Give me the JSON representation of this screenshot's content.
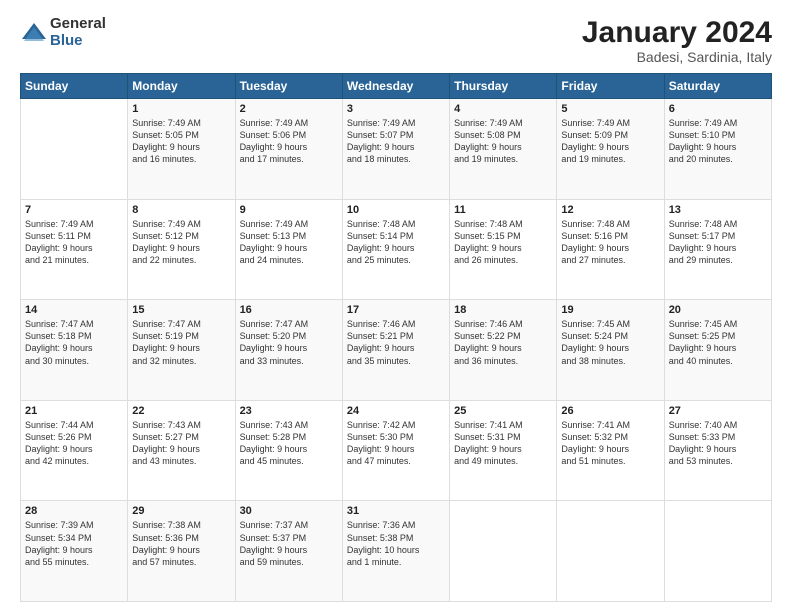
{
  "logo": {
    "general": "General",
    "blue": "Blue"
  },
  "title": "January 2024",
  "location": "Badesi, Sardinia, Italy",
  "days_of_week": [
    "Sunday",
    "Monday",
    "Tuesday",
    "Wednesday",
    "Thursday",
    "Friday",
    "Saturday"
  ],
  "weeks": [
    [
      {
        "day": "",
        "info": ""
      },
      {
        "day": "1",
        "info": "Sunrise: 7:49 AM\nSunset: 5:05 PM\nDaylight: 9 hours\nand 16 minutes."
      },
      {
        "day": "2",
        "info": "Sunrise: 7:49 AM\nSunset: 5:06 PM\nDaylight: 9 hours\nand 17 minutes."
      },
      {
        "day": "3",
        "info": "Sunrise: 7:49 AM\nSunset: 5:07 PM\nDaylight: 9 hours\nand 18 minutes."
      },
      {
        "day": "4",
        "info": "Sunrise: 7:49 AM\nSunset: 5:08 PM\nDaylight: 9 hours\nand 19 minutes."
      },
      {
        "day": "5",
        "info": "Sunrise: 7:49 AM\nSunset: 5:09 PM\nDaylight: 9 hours\nand 19 minutes."
      },
      {
        "day": "6",
        "info": "Sunrise: 7:49 AM\nSunset: 5:10 PM\nDaylight: 9 hours\nand 20 minutes."
      }
    ],
    [
      {
        "day": "7",
        "info": "Sunrise: 7:49 AM\nSunset: 5:11 PM\nDaylight: 9 hours\nand 21 minutes."
      },
      {
        "day": "8",
        "info": "Sunrise: 7:49 AM\nSunset: 5:12 PM\nDaylight: 9 hours\nand 22 minutes."
      },
      {
        "day": "9",
        "info": "Sunrise: 7:49 AM\nSunset: 5:13 PM\nDaylight: 9 hours\nand 24 minutes."
      },
      {
        "day": "10",
        "info": "Sunrise: 7:48 AM\nSunset: 5:14 PM\nDaylight: 9 hours\nand 25 minutes."
      },
      {
        "day": "11",
        "info": "Sunrise: 7:48 AM\nSunset: 5:15 PM\nDaylight: 9 hours\nand 26 minutes."
      },
      {
        "day": "12",
        "info": "Sunrise: 7:48 AM\nSunset: 5:16 PM\nDaylight: 9 hours\nand 27 minutes."
      },
      {
        "day": "13",
        "info": "Sunrise: 7:48 AM\nSunset: 5:17 PM\nDaylight: 9 hours\nand 29 minutes."
      }
    ],
    [
      {
        "day": "14",
        "info": "Sunrise: 7:47 AM\nSunset: 5:18 PM\nDaylight: 9 hours\nand 30 minutes."
      },
      {
        "day": "15",
        "info": "Sunrise: 7:47 AM\nSunset: 5:19 PM\nDaylight: 9 hours\nand 32 minutes."
      },
      {
        "day": "16",
        "info": "Sunrise: 7:47 AM\nSunset: 5:20 PM\nDaylight: 9 hours\nand 33 minutes."
      },
      {
        "day": "17",
        "info": "Sunrise: 7:46 AM\nSunset: 5:21 PM\nDaylight: 9 hours\nand 35 minutes."
      },
      {
        "day": "18",
        "info": "Sunrise: 7:46 AM\nSunset: 5:22 PM\nDaylight: 9 hours\nand 36 minutes."
      },
      {
        "day": "19",
        "info": "Sunrise: 7:45 AM\nSunset: 5:24 PM\nDaylight: 9 hours\nand 38 minutes."
      },
      {
        "day": "20",
        "info": "Sunrise: 7:45 AM\nSunset: 5:25 PM\nDaylight: 9 hours\nand 40 minutes."
      }
    ],
    [
      {
        "day": "21",
        "info": "Sunrise: 7:44 AM\nSunset: 5:26 PM\nDaylight: 9 hours\nand 42 minutes."
      },
      {
        "day": "22",
        "info": "Sunrise: 7:43 AM\nSunset: 5:27 PM\nDaylight: 9 hours\nand 43 minutes."
      },
      {
        "day": "23",
        "info": "Sunrise: 7:43 AM\nSunset: 5:28 PM\nDaylight: 9 hours\nand 45 minutes."
      },
      {
        "day": "24",
        "info": "Sunrise: 7:42 AM\nSunset: 5:30 PM\nDaylight: 9 hours\nand 47 minutes."
      },
      {
        "day": "25",
        "info": "Sunrise: 7:41 AM\nSunset: 5:31 PM\nDaylight: 9 hours\nand 49 minutes."
      },
      {
        "day": "26",
        "info": "Sunrise: 7:41 AM\nSunset: 5:32 PM\nDaylight: 9 hours\nand 51 minutes."
      },
      {
        "day": "27",
        "info": "Sunrise: 7:40 AM\nSunset: 5:33 PM\nDaylight: 9 hours\nand 53 minutes."
      }
    ],
    [
      {
        "day": "28",
        "info": "Sunrise: 7:39 AM\nSunset: 5:34 PM\nDaylight: 9 hours\nand 55 minutes."
      },
      {
        "day": "29",
        "info": "Sunrise: 7:38 AM\nSunset: 5:36 PM\nDaylight: 9 hours\nand 57 minutes."
      },
      {
        "day": "30",
        "info": "Sunrise: 7:37 AM\nSunset: 5:37 PM\nDaylight: 9 hours\nand 59 minutes."
      },
      {
        "day": "31",
        "info": "Sunrise: 7:36 AM\nSunset: 5:38 PM\nDaylight: 10 hours\nand 1 minute."
      },
      {
        "day": "",
        "info": ""
      },
      {
        "day": "",
        "info": ""
      },
      {
        "day": "",
        "info": ""
      }
    ]
  ]
}
